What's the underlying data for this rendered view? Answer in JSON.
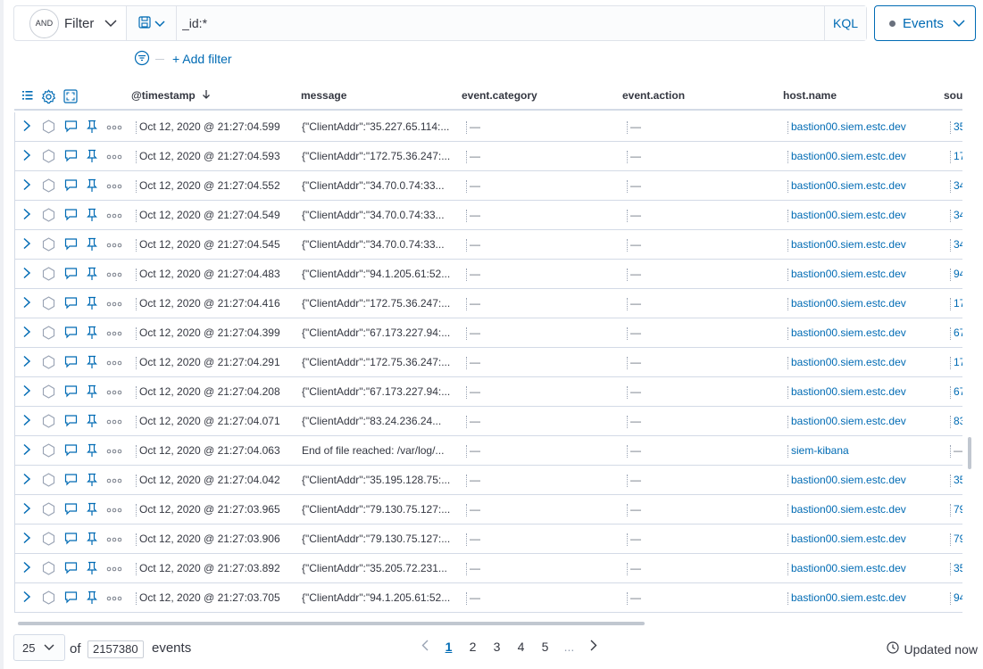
{
  "query_bar": {
    "and_label": "AND",
    "filter_label": "Filter",
    "query_value": "_id:*",
    "language": "KQL"
  },
  "events_selector": {
    "label": "Events"
  },
  "add_filter": {
    "label": "+ Add filter"
  },
  "columns": {
    "timestamp": "@timestamp",
    "message": "message",
    "category": "event.category",
    "action": "event.action",
    "host": "host.name",
    "source": "sou"
  },
  "rows": [
    {
      "timestamp": "Oct 12, 2020 @ 21:27:04.599",
      "message": "{\"ClientAddr\":\"35.227.65.114:...",
      "category": "—",
      "action": "—",
      "host": "bastion00.siem.estc.dev",
      "source": "35"
    },
    {
      "timestamp": "Oct 12, 2020 @ 21:27:04.593",
      "message": "{\"ClientAddr\":\"172.75.36.247:...",
      "category": "—",
      "action": "—",
      "host": "bastion00.siem.estc.dev",
      "source": "17"
    },
    {
      "timestamp": "Oct 12, 2020 @ 21:27:04.552",
      "message": "{\"ClientAddr\":\"34.70.0.74:33...",
      "category": "—",
      "action": "—",
      "host": "bastion00.siem.estc.dev",
      "source": "34"
    },
    {
      "timestamp": "Oct 12, 2020 @ 21:27:04.549",
      "message": "{\"ClientAddr\":\"34.70.0.74:33...",
      "category": "—",
      "action": "—",
      "host": "bastion00.siem.estc.dev",
      "source": "34"
    },
    {
      "timestamp": "Oct 12, 2020 @ 21:27:04.545",
      "message": "{\"ClientAddr\":\"34.70.0.74:33...",
      "category": "—",
      "action": "—",
      "host": "bastion00.siem.estc.dev",
      "source": "34"
    },
    {
      "timestamp": "Oct 12, 2020 @ 21:27:04.483",
      "message": "{\"ClientAddr\":\"94.1.205.61:52...",
      "category": "—",
      "action": "—",
      "host": "bastion00.siem.estc.dev",
      "source": "94"
    },
    {
      "timestamp": "Oct 12, 2020 @ 21:27:04.416",
      "message": "{\"ClientAddr\":\"172.75.36.247:...",
      "category": "—",
      "action": "—",
      "host": "bastion00.siem.estc.dev",
      "source": "17"
    },
    {
      "timestamp": "Oct 12, 2020 @ 21:27:04.399",
      "message": "{\"ClientAddr\":\"67.173.227.94:...",
      "category": "—",
      "action": "—",
      "host": "bastion00.siem.estc.dev",
      "source": "67"
    },
    {
      "timestamp": "Oct 12, 2020 @ 21:27:04.291",
      "message": "{\"ClientAddr\":\"172.75.36.247:...",
      "category": "—",
      "action": "—",
      "host": "bastion00.siem.estc.dev",
      "source": "17"
    },
    {
      "timestamp": "Oct 12, 2020 @ 21:27:04.208",
      "message": "{\"ClientAddr\":\"67.173.227.94:...",
      "category": "—",
      "action": "—",
      "host": "bastion00.siem.estc.dev",
      "source": "67"
    },
    {
      "timestamp": "Oct 12, 2020 @ 21:27:04.071",
      "message": "{\"ClientAddr\":\"83.24.236.24...",
      "category": "—",
      "action": "—",
      "host": "bastion00.siem.estc.dev",
      "source": "83"
    },
    {
      "timestamp": "Oct 12, 2020 @ 21:27:04.063",
      "message": "End of file reached: /var/log/...",
      "category": "—",
      "action": "—",
      "host": "siem-kibana",
      "source": "—"
    },
    {
      "timestamp": "Oct 12, 2020 @ 21:27:04.042",
      "message": "{\"ClientAddr\":\"35.195.128.75:...",
      "category": "—",
      "action": "—",
      "host": "bastion00.siem.estc.dev",
      "source": "35"
    },
    {
      "timestamp": "Oct 12, 2020 @ 21:27:03.965",
      "message": "{\"ClientAddr\":\"79.130.75.127:...",
      "category": "—",
      "action": "—",
      "host": "bastion00.siem.estc.dev",
      "source": "79"
    },
    {
      "timestamp": "Oct 12, 2020 @ 21:27:03.906",
      "message": "{\"ClientAddr\":\"79.130.75.127:...",
      "category": "—",
      "action": "—",
      "host": "bastion00.siem.estc.dev",
      "source": "79"
    },
    {
      "timestamp": "Oct 12, 2020 @ 21:27:03.892",
      "message": "{\"ClientAddr\":\"35.205.72.231...",
      "category": "—",
      "action": "—",
      "host": "bastion00.siem.estc.dev",
      "source": "35"
    },
    {
      "timestamp": "Oct 12, 2020 @ 21:27:03.705",
      "message": "{\"ClientAddr\":\"94.1.205.61:52...",
      "category": "—",
      "action": "—",
      "host": "bastion00.siem.estc.dev",
      "source": "94"
    }
  ],
  "footer": {
    "per_page": "25",
    "of_label": "of",
    "total_count": "2157380",
    "events_label": "events",
    "pages": [
      "1",
      "2",
      "3",
      "4",
      "5"
    ],
    "ellipsis": "...",
    "current_page": "1",
    "updated": "Updated now"
  },
  "colors": {
    "link": "#006bb4",
    "text": "#343741",
    "border": "#d3dae6"
  }
}
